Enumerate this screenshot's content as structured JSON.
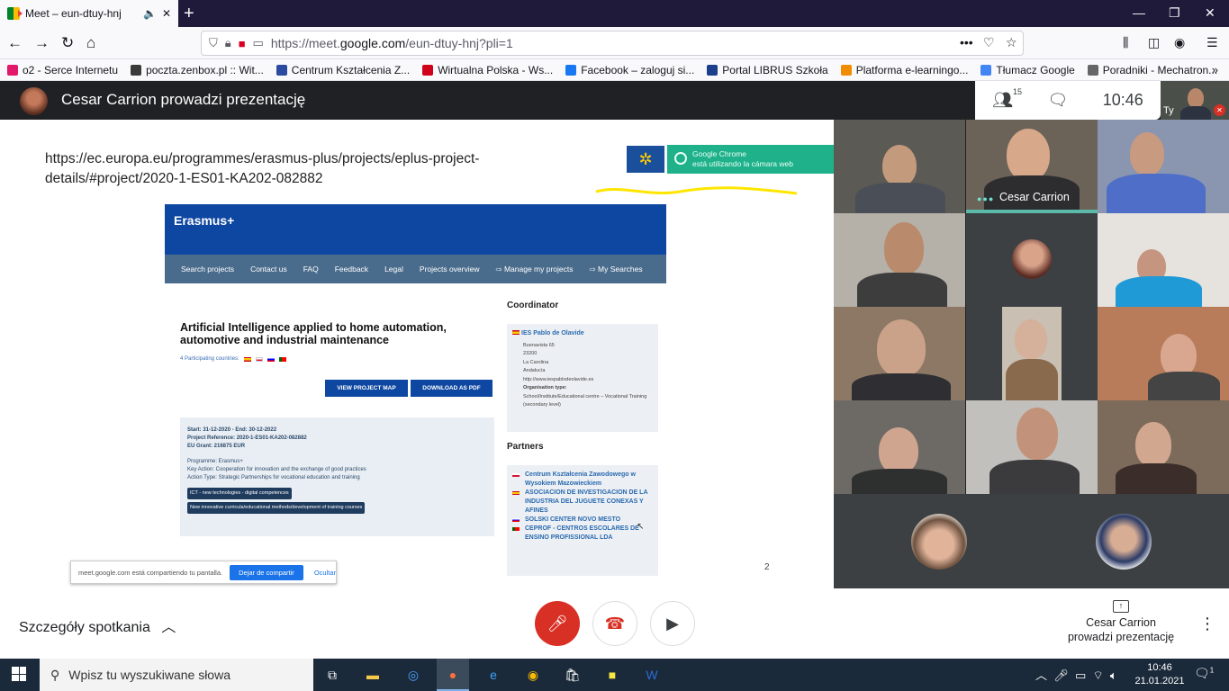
{
  "browser": {
    "tab_title": "Meet – eun-dtuy-hnj",
    "url_prefix": "https://meet.",
    "url_domain": "google.com",
    "url_path": "/eun-dtuy-hnj?pli=1",
    "bookmarks": [
      {
        "label": "o2 - Serce Internetu",
        "color": "#e2196a"
      },
      {
        "label": "poczta.zenbox.pl :: Wit...",
        "color": "#3a3a3a"
      },
      {
        "label": "Centrum Kształcenia Z...",
        "color": "#2b4aa0"
      },
      {
        "label": "Wirtualna Polska - Ws...",
        "color": "#d0021b"
      },
      {
        "label": "Facebook – zaloguj si...",
        "color": "#1877f2"
      },
      {
        "label": "Portal LIBRUS Szkoła",
        "color": "#1c3f8c"
      },
      {
        "label": "Platforma e-learningo...",
        "color": "#f08c00"
      },
      {
        "label": "Tłumacz Google",
        "color": "#4285f4"
      },
      {
        "label": "Poradniki - Mechatron...",
        "color": "#666666"
      }
    ]
  },
  "meet": {
    "presenter_title": "Cesar Carrion prowadzi prezentację",
    "participants_count": "15",
    "clock": "10:46",
    "self_label": "Ty",
    "active_speaker": "Cesar Carrion",
    "meeting_details": "Szczegóły spotkania",
    "presenting_line1": "Cesar Carrion",
    "presenting_line2": "prowadzi prezentację"
  },
  "slide": {
    "url_text": "https://ec.europa.eu/programmes/erasmus-plus/projects/eplus-project-details/#project/2020-1-ES01-KA202-082882",
    "chrome_notice_line1": "Google Chrome",
    "chrome_notice_line2": "está utilizando la cámara web",
    "page_number": "2",
    "erasmus": {
      "brand": "Erasmus+",
      "nav": [
        "Search projects",
        "Contact us",
        "FAQ",
        "Feedback",
        "Legal",
        "Projects overview",
        "⇨ Manage my projects",
        "⇨ My Searches"
      ],
      "project_title": "Artificial Intelligence applied to home automation, automotive and industrial maintenance",
      "countries_label": "4 Participating countries:",
      "btn_map": "VIEW PROJECT MAP",
      "btn_pdf": "DOWNLOAD AS PDF",
      "info_dates": "Start: 31-12-2020 - End: 30-12-2022",
      "info_ref": "Project Reference: 2020-1-ES01-KA202-082882",
      "info_grant": "EU Grant: 216875 EUR",
      "programme": "Programme: Erasmus+",
      "key_action": "Key Action: Cooperation for innovation and the exchange of good practices",
      "action_type": "Action Type: Strategic Partnerships for vocational education and training",
      "tag1": "ICT - new technologies - digital competences",
      "tag2": "New innovative curricula/educational methods/development of training courses",
      "coordinator_head": "Coordinator",
      "coordinator_name": "IES Pablo de Olavide",
      "coordinator_lines": [
        "Buenavista 65",
        "23200",
        "La Carolina",
        "Andalucía",
        "http://www.iespablodeolavide.es"
      ],
      "org_type_label": "Organisation type:",
      "org_type": "School/Institute/Educational centre – Vocational Training (secondary level)",
      "partners_head": "Partners",
      "partners": [
        {
          "name": "Centrum Kształcenia Zawodowego w Wysokiem Mazowieckiem",
          "flag": "pl"
        },
        {
          "name": "ASOCIACION DE INVESTIGACION DE LA INDUSTRIA DEL JUGUETE CONEXAS Y AFINES",
          "flag": "es"
        },
        {
          "name": "SOLSKI CENTER NOVO MESTO",
          "flag": "si"
        },
        {
          "name": "CEPROF - CENTROS ESCOLARES DE ENSINO PROFISSIONAL LDA",
          "flag": "pt"
        }
      ]
    },
    "share_notice": "meet.google.com está compartiendo tu pantalla.",
    "share_stop": "Dejar de compartir",
    "share_hide": "Ocultar"
  },
  "taskbar": {
    "search_placeholder": "Wpisz tu wyszukiwane słowa",
    "time": "10:46",
    "date": "21.01.2021",
    "notifications": "1"
  },
  "colors": {
    "erasmus_blue": "#0e47a1",
    "mic_off_red": "#d93025",
    "speaker_teal": "#5bb9a9"
  }
}
